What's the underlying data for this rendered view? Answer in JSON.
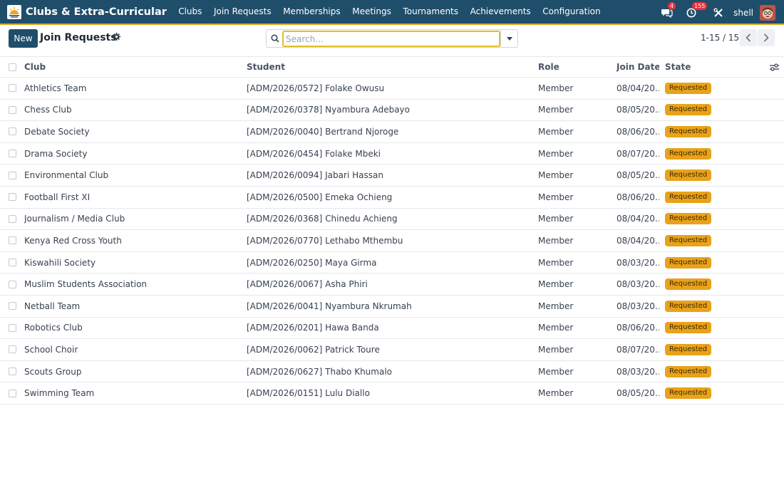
{
  "app": {
    "name": "Clubs & Extra-Curricular",
    "logo_icon": "sunrise-logo-icon",
    "menu": [
      "Clubs",
      "Join Requests",
      "Memberships",
      "Meetings",
      "Tournaments",
      "Achievements",
      "Configuration"
    ]
  },
  "systray": {
    "messages_badge": "4",
    "activity_badge": "155",
    "user_name": "shell"
  },
  "toolbar": {
    "new_label": "New",
    "title": "Join Requests",
    "search_placeholder": "Search...",
    "pager_text": "1-15 / 15"
  },
  "table": {
    "columns": [
      "Club",
      "Student",
      "Role",
      "Join Date",
      "State"
    ],
    "rows": [
      {
        "club": "Athletics Team",
        "student": "[ADM/2026/0572] Folake Owusu",
        "role": "Member",
        "date": "08/04/20…",
        "state": "Requested"
      },
      {
        "club": "Chess Club",
        "student": "[ADM/2026/0378] Nyambura Adebayo",
        "role": "Member",
        "date": "08/05/20…",
        "state": "Requested"
      },
      {
        "club": "Debate Society",
        "student": "[ADM/2026/0040] Bertrand Njoroge",
        "role": "Member",
        "date": "08/06/20…",
        "state": "Requested"
      },
      {
        "club": "Drama Society",
        "student": "[ADM/2026/0454] Folake Mbeki",
        "role": "Member",
        "date": "08/07/20…",
        "state": "Requested"
      },
      {
        "club": "Environmental Club",
        "student": "[ADM/2026/0094] Jabari Hassan",
        "role": "Member",
        "date": "08/05/20…",
        "state": "Requested"
      },
      {
        "club": "Football First XI",
        "student": "[ADM/2026/0500] Emeka Ochieng",
        "role": "Member",
        "date": "08/06/20…",
        "state": "Requested"
      },
      {
        "club": "Journalism / Media Club",
        "student": "[ADM/2026/0368] Chinedu Achieng",
        "role": "Member",
        "date": "08/04/20…",
        "state": "Requested"
      },
      {
        "club": "Kenya Red Cross Youth",
        "student": "[ADM/2026/0770] Lethabo Mthembu",
        "role": "Member",
        "date": "08/04/20…",
        "state": "Requested"
      },
      {
        "club": "Kiswahili Society",
        "student": "[ADM/2026/0250] Maya Girma",
        "role": "Member",
        "date": "08/03/20…",
        "state": "Requested"
      },
      {
        "club": "Muslim Students Association",
        "student": "[ADM/2026/0067] Asha Phiri",
        "role": "Member",
        "date": "08/03/20…",
        "state": "Requested"
      },
      {
        "club": "Netball Team",
        "student": "[ADM/2026/0041] Nyambura Nkrumah",
        "role": "Member",
        "date": "08/03/20…",
        "state": "Requested"
      },
      {
        "club": "Robotics Club",
        "student": "[ADM/2026/0201] Hawa Banda",
        "role": "Member",
        "date": "08/06/20…",
        "state": "Requested"
      },
      {
        "club": "School Choir",
        "student": "[ADM/2026/0062] Patrick Toure",
        "role": "Member",
        "date": "08/07/20…",
        "state": "Requested"
      },
      {
        "club": "Scouts Group",
        "student": "[ADM/2026/0627] Thabo Khumalo",
        "role": "Member",
        "date": "08/03/20…",
        "state": "Requested"
      },
      {
        "club": "Swimming Team",
        "student": "[ADM/2026/0151] Lulu Diallo",
        "role": "Member",
        "date": "08/05/20…",
        "state": "Requested"
      }
    ]
  },
  "colors": {
    "navbar": "#1f4e6b",
    "accent": "#e4a31f",
    "state_requested": "#e9a21a",
    "badge": "#e5323e"
  }
}
